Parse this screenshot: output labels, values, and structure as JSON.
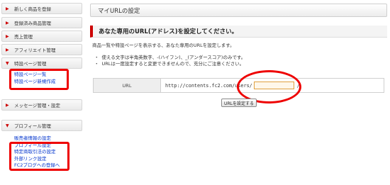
{
  "sidebar": {
    "menu": [
      {
        "label": "新しく商品を登録",
        "arrow": "▶"
      },
      {
        "label": "登録済み商品管理",
        "arrow": "▶"
      },
      {
        "label": "売上管理",
        "arrow": "▶"
      },
      {
        "label": "アフィリエイト管理",
        "arrow": "▶"
      },
      {
        "label": "特設ページ管理",
        "arrow": "▼"
      },
      {
        "label": "メッセージ管理・設定",
        "arrow": "▶"
      },
      {
        "label": "プロフィール管理",
        "arrow": "▼"
      }
    ],
    "special_page_links": [
      "特設ページ一覧",
      "特設ページ新規作成"
    ],
    "profile_links": [
      "販売者情報の設定",
      "プロフィール設定",
      "特定商取引法の設定",
      "外部リンク設定",
      "FC2ブログへの登録へ"
    ]
  },
  "main": {
    "page_title": "マイURLの設定",
    "section_title": "あなた専用のURL(アドレス)を設定してください。",
    "description": "商品一覧や特設ページを表示する、あなた専用のURLを設定します。",
    "bullets": [
      "使える文字は半角英数字、-(ハイフン)、_(アンダースコア)のみです。",
      "URLは一度設定すると変更できませんので、充分にご注意ください。"
    ],
    "bullet_symbol": "・",
    "url_label": "URL",
    "url_prefix": "http://contents.fc2.com/users/",
    "url_input_value": "",
    "url_suffix": "/",
    "submit_label": "URLを設定する"
  },
  "colors": {
    "accent": "#cc0000",
    "link": "#0033cc",
    "annotation": "#ee0000"
  }
}
